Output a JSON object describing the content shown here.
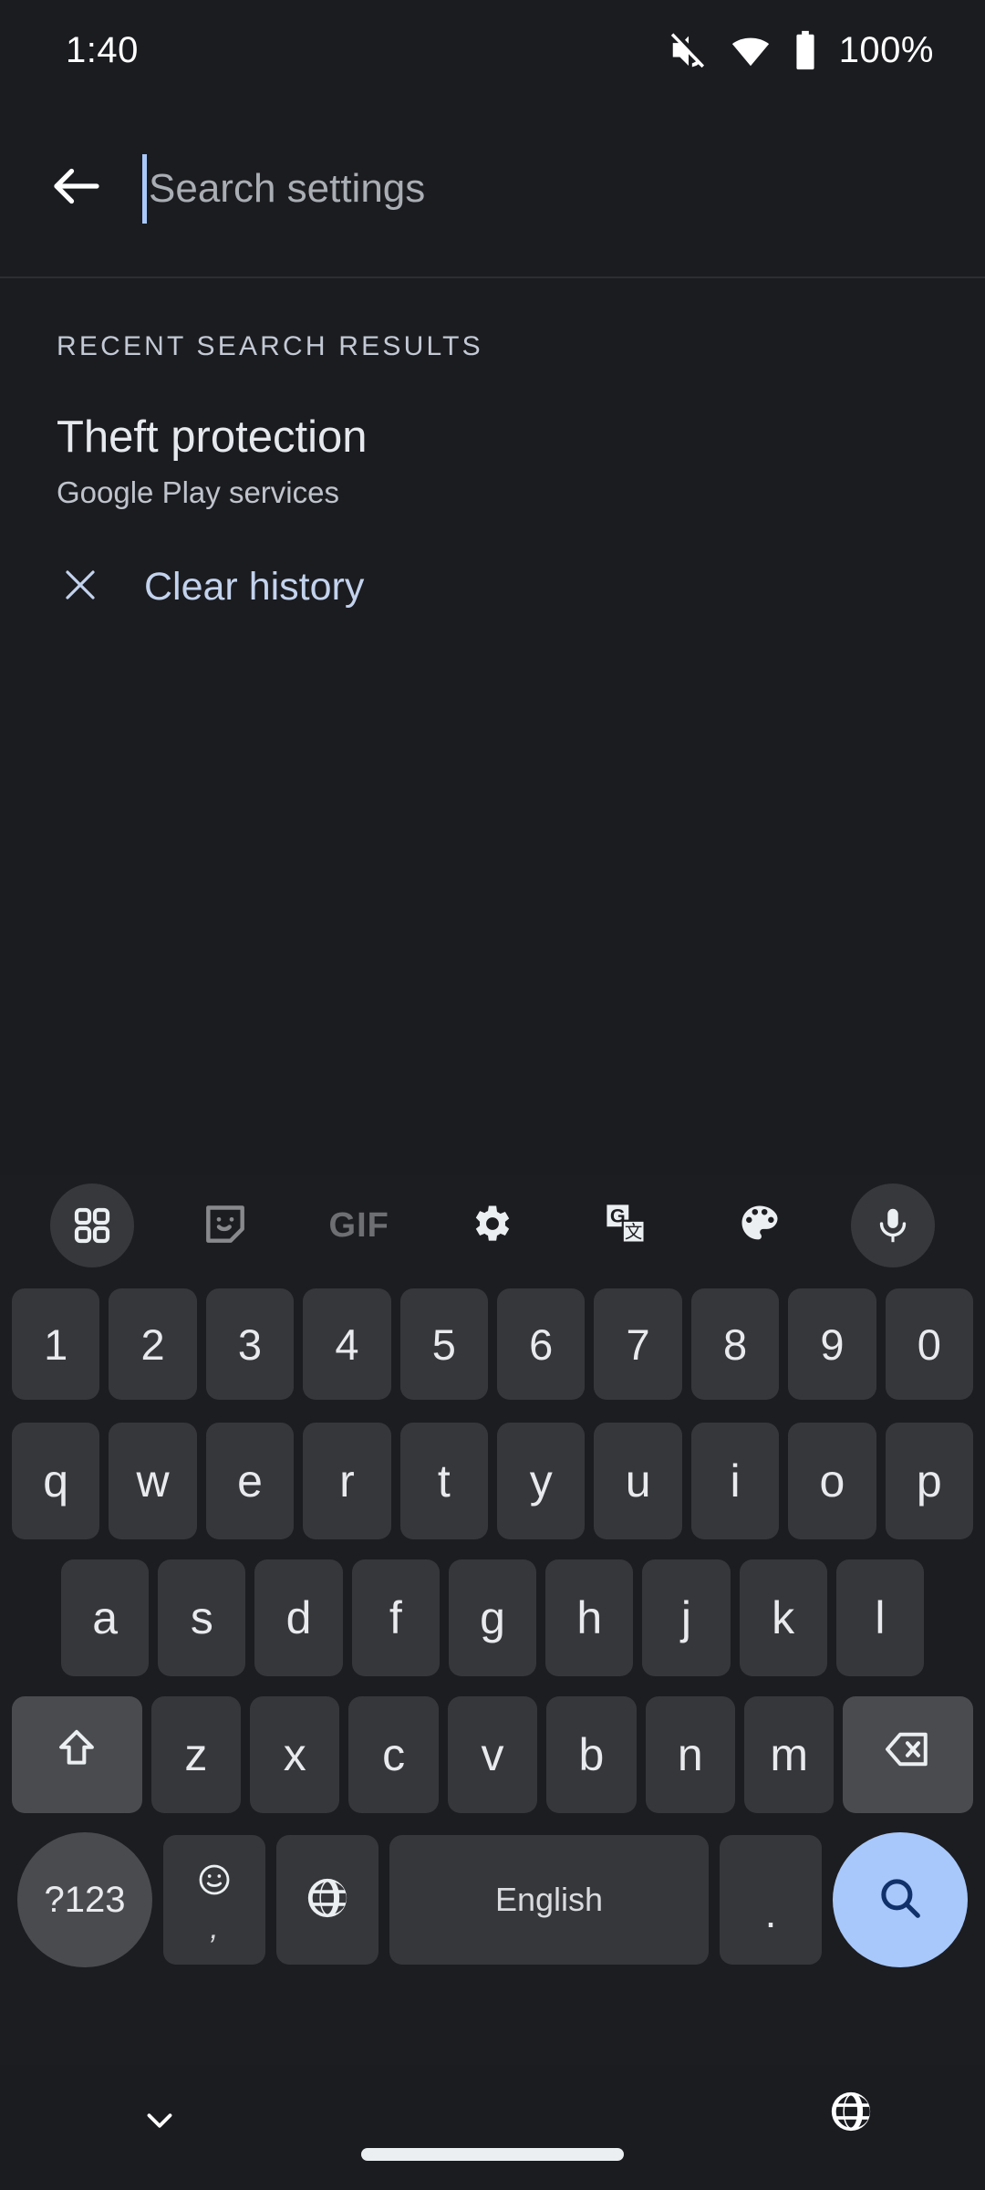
{
  "status_bar": {
    "time": "1:40",
    "battery_percent": "100%",
    "icons": [
      "volume-off-icon",
      "wifi-icon",
      "battery-full-icon"
    ]
  },
  "search_bar": {
    "back_icon": "arrow-back-icon",
    "placeholder": "Search settings",
    "value": "",
    "caret_color": "#a8c7fa"
  },
  "results": {
    "header": "RECENT SEARCH RESULTS",
    "items": [
      {
        "title": "Theft protection",
        "subtitle": "Google Play services"
      }
    ],
    "clear_history": {
      "icon": "close-icon",
      "label": "Clear history",
      "color": "#c3d3ee"
    }
  },
  "keyboard": {
    "toolbar": [
      {
        "name": "apps-grid-icon",
        "label": ""
      },
      {
        "name": "sticker-icon",
        "label": ""
      },
      {
        "name": "gif-icon",
        "label": "GIF"
      },
      {
        "name": "settings-gear-icon",
        "label": ""
      },
      {
        "name": "translate-icon",
        "label": ""
      },
      {
        "name": "palette-icon",
        "label": ""
      },
      {
        "name": "microphone-icon",
        "label": ""
      }
    ],
    "row_numbers": [
      "1",
      "2",
      "3",
      "4",
      "5",
      "6",
      "7",
      "8",
      "9",
      "0"
    ],
    "row_q": [
      "q",
      "w",
      "e",
      "r",
      "t",
      "y",
      "u",
      "i",
      "o",
      "p"
    ],
    "row_a": [
      "a",
      "s",
      "d",
      "f",
      "g",
      "h",
      "j",
      "k",
      "l"
    ],
    "row_z": {
      "shift": "shift-icon",
      "letters": [
        "z",
        "x",
        "c",
        "v",
        "b",
        "n",
        "m"
      ],
      "backspace": "backspace-icon"
    },
    "row_bottom": {
      "symbols": "?123",
      "emoji_icon": "emoji-smiley-icon",
      "emoji_secondary": ",",
      "globe_icon": "globe-icon",
      "space_label": "English",
      "period": ".",
      "enter_icon": "search-icon",
      "enter_color": "#a8c7fa"
    }
  },
  "nav_bar": {
    "hide_keyboard_icon": "chevron-down-icon",
    "home_pill": "home-pill",
    "ime_switch_icon": "globe-icon"
  }
}
